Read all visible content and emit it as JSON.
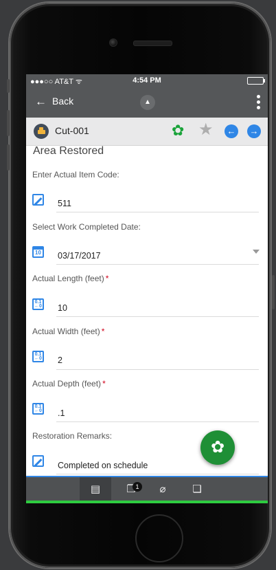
{
  "status_bar": {
    "carrier": "●●●○○ AT&T ᯤ",
    "time": "4:54 PM"
  },
  "app_bar": {
    "back_label": "Back",
    "back_icon": "←",
    "center_icon": "cone-icon"
  },
  "title_bar": {
    "title": "Cut-001",
    "gear_glyph": "✿",
    "star_glyph": "★",
    "prev_glyph": "←",
    "next_glyph": "→"
  },
  "form": {
    "section_title": "Area Restored",
    "fields": [
      {
        "label": "Enter Actual Item Code:",
        "value": "511",
        "required": false,
        "icon": "edit-icon"
      },
      {
        "label": "Select Work Completed Date:",
        "value": "03/17/2017",
        "required": false,
        "icon": "calendar-icon",
        "cal_day": "10"
      },
      {
        "label": "Actual Length (feet)",
        "value": "10",
        "required": true,
        "icon": "measure-icon"
      },
      {
        "label": "Actual Width (feet)",
        "value": "2",
        "required": true,
        "icon": "measure-icon"
      },
      {
        "label": "Actual Depth (feet)",
        "value": ".1",
        "required": true,
        "icon": "measure-icon"
      },
      {
        "label": "Restoration Remarks:",
        "value": "Completed on schedule",
        "required": false,
        "icon": "edit-icon"
      }
    ],
    "required_mark": "*",
    "measure_glyph": "0.1\n←0"
  },
  "fab": {
    "glyph": "✿"
  },
  "bottom_tabs": [
    {
      "name": "document-icon",
      "glyph": "▤"
    },
    {
      "name": "copies-icon",
      "glyph": "❐",
      "badge": "1"
    },
    {
      "name": "paperclip-icon",
      "glyph": "⌀"
    },
    {
      "name": "comments-icon",
      "glyph": "❏"
    }
  ],
  "colors": {
    "accent": "#2f86e6",
    "fab": "#1f8f36",
    "gear": "#1aa33a",
    "bar": "#555759"
  }
}
